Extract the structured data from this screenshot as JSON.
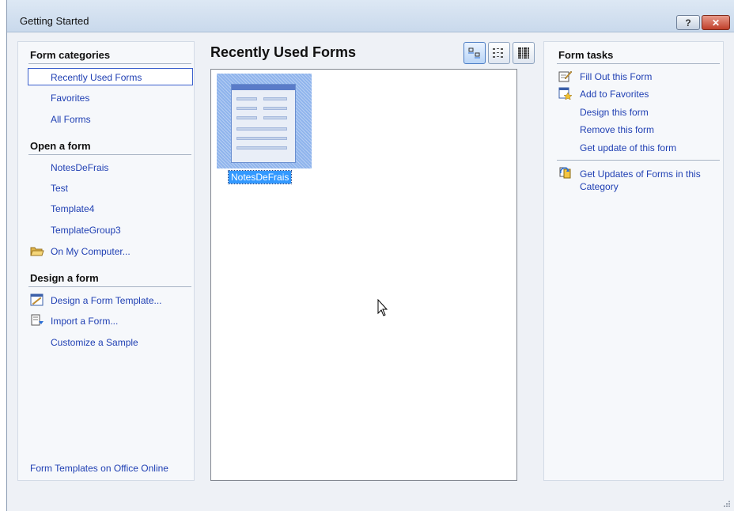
{
  "window": {
    "title": "Getting Started",
    "help_glyph": "?",
    "close_glyph": "✕"
  },
  "left_panel": {
    "categories_heading": "Form categories",
    "categories": [
      {
        "label": "Recently Used Forms",
        "selected": true
      },
      {
        "label": "Favorites"
      },
      {
        "label": "All Forms"
      }
    ],
    "open_heading": "Open a form",
    "open_items": [
      {
        "label": "NotesDeFrais"
      },
      {
        "label": "Test"
      },
      {
        "label": "Template4"
      },
      {
        "label": "TemplateGroup3"
      },
      {
        "label": "On My Computer...",
        "icon": "folder-open-icon"
      }
    ],
    "design_heading": "Design a form",
    "design_items": [
      {
        "label": "Design a Form Template...",
        "icon": "design-template-icon"
      },
      {
        "label": "Import a Form...",
        "icon": "import-form-icon"
      },
      {
        "label": "Customize a Sample"
      }
    ],
    "footer_link": "Form Templates on Office Online"
  },
  "center": {
    "title": "Recently Used Forms",
    "view_buttons": [
      {
        "icon": "large-icons-view-icon",
        "active": true
      },
      {
        "icon": "tiles-view-icon",
        "active": false
      },
      {
        "icon": "list-view-icon",
        "active": false
      }
    ],
    "forms": [
      {
        "name": "NotesDeFrais",
        "selected": true
      }
    ]
  },
  "right_panel": {
    "heading": "Form tasks",
    "tasks": [
      {
        "label": "Fill Out this Form",
        "icon": "fill-out-form-icon"
      },
      {
        "label": "Add to Favorites",
        "icon": "add-favorites-icon"
      },
      {
        "label": "Design this form"
      },
      {
        "label": "Remove this form"
      },
      {
        "label": "Get update of this form"
      }
    ],
    "category_task": {
      "line1": "Get Updates of Forms in this",
      "line2": "Category",
      "icon": "get-updates-icon"
    }
  }
}
